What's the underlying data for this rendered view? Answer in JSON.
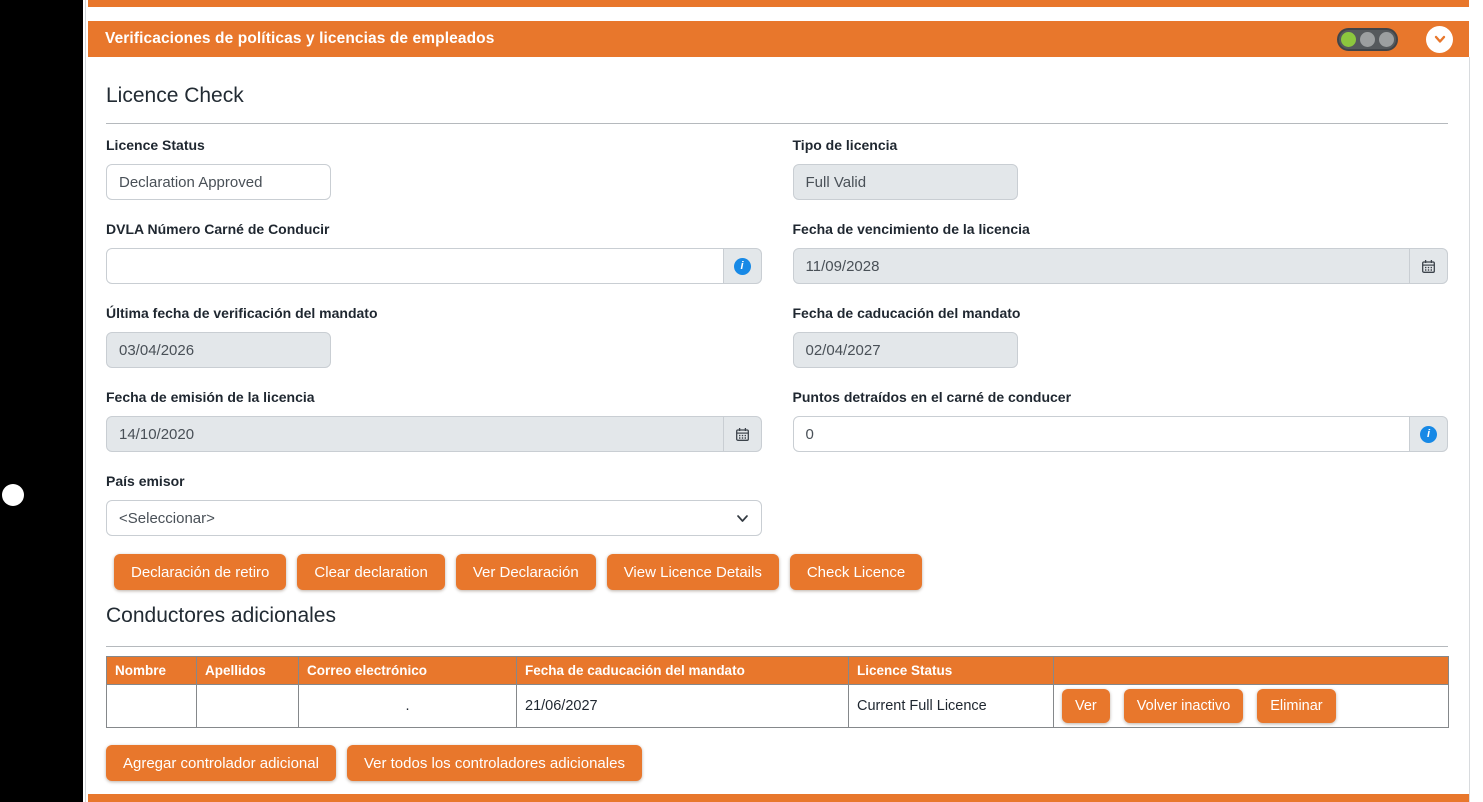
{
  "colors": {
    "accent": "#E8772C",
    "info_blue": "#1789E6",
    "traffic_green": "#8CC63E",
    "traffic_inactive": "#9C9FA0"
  },
  "panel_header": {
    "title": "Verificaciones de políticas y licencias de empleados",
    "traffic_lights": [
      "green",
      "inactive",
      "inactive"
    ]
  },
  "licence_check": {
    "title": "Licence Check",
    "fields": [
      {
        "label": "Licence Status",
        "value": "Declaration Approved"
      },
      {
        "label": "Tipo de licencia",
        "value": "Full Valid"
      },
      {
        "label": "DVLA Número Carné de Conducir",
        "value": ""
      },
      {
        "label": "Fecha de vencimiento de la licencia",
        "value": "11/09/2028"
      },
      {
        "label": "Última fecha de verificación del mandato",
        "value": "03/04/2026"
      },
      {
        "label": "Fecha de caducación del mandato",
        "value": "02/04/2027"
      },
      {
        "label": "Fecha de emisión de la licencia",
        "value": "14/10/2020"
      },
      {
        "label": "Puntos detraídos en el carné de conducer",
        "value": "0"
      },
      {
        "label": "País emisor",
        "value": "<Seleccionar>"
      }
    ],
    "buttons": [
      "Declaración de retiro",
      "Clear declaration",
      "Ver Declaración",
      "View Licence Details",
      "Check Licence"
    ]
  },
  "additional_drivers": {
    "title": "Conductores adicionales",
    "table": {
      "columns": [
        "Nombre",
        "Apellidos",
        "Correo electrónico",
        "Fecha de caducación del mandato",
        "Licence Status",
        ""
      ],
      "row": {
        "nombre": "",
        "apellidos": "",
        "correo": ".",
        "fecha_caducacion": "21/06/2027",
        "licence_status": "Current Full Licence"
      },
      "row_actions": [
        "Ver",
        "Volver inactivo",
        "Eliminar"
      ]
    },
    "buttons": [
      "Agregar controlador adicional",
      "Ver todos los controladores adicionales"
    ]
  }
}
